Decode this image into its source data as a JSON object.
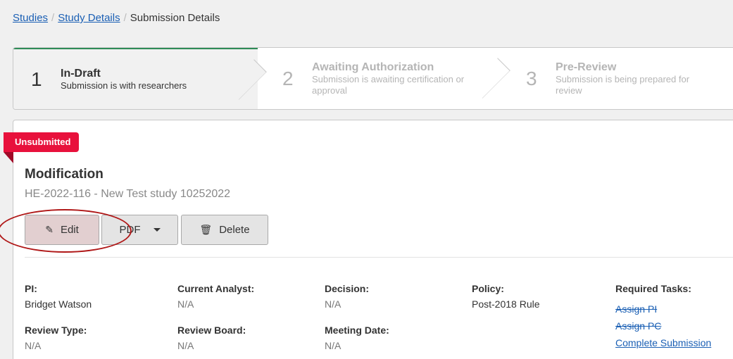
{
  "breadcrumb": {
    "items": [
      "Studies",
      "Study Details",
      "Submission Details"
    ],
    "separator": "/"
  },
  "steps": [
    {
      "number": "1",
      "title": "In-Draft",
      "description": "Submission is with researchers"
    },
    {
      "number": "2",
      "title": "Awaiting Authorization",
      "description": "Submission is awaiting certification or approval"
    },
    {
      "number": "3",
      "title": "Pre-Review",
      "description": "Submission is being prepared for review"
    }
  ],
  "status_badge": "Unsubmitted",
  "submission": {
    "type": "Modification",
    "subtitle": "HE-2022-116 - New Test study 10252022"
  },
  "actions": {
    "edit_label": "Edit",
    "pdf_label": "PDF",
    "delete_label": "Delete"
  },
  "fields": {
    "pi": {
      "label": "PI:",
      "value": "Bridget Watson"
    },
    "current_analyst": {
      "label": "Current Analyst:",
      "value": "N/A"
    },
    "decision": {
      "label": "Decision:",
      "value": "N/A"
    },
    "policy": {
      "label": "Policy:",
      "value": "Post-2018 Rule"
    },
    "review_type": {
      "label": "Review Type:",
      "value": "N/A"
    },
    "review_board": {
      "label": "Review Board:",
      "value": "N/A"
    },
    "meeting_date": {
      "label": "Meeting Date:",
      "value": "N/A"
    }
  },
  "required_tasks": {
    "label": "Required Tasks:",
    "items": [
      "Assign PI",
      "Assign PC",
      "Complete Submission"
    ]
  },
  "colors": {
    "accent_link": "#1a5fb4",
    "badge": "#e8113c",
    "active_step_border": "#2e8b57",
    "annotation_circle": "#b01818"
  }
}
